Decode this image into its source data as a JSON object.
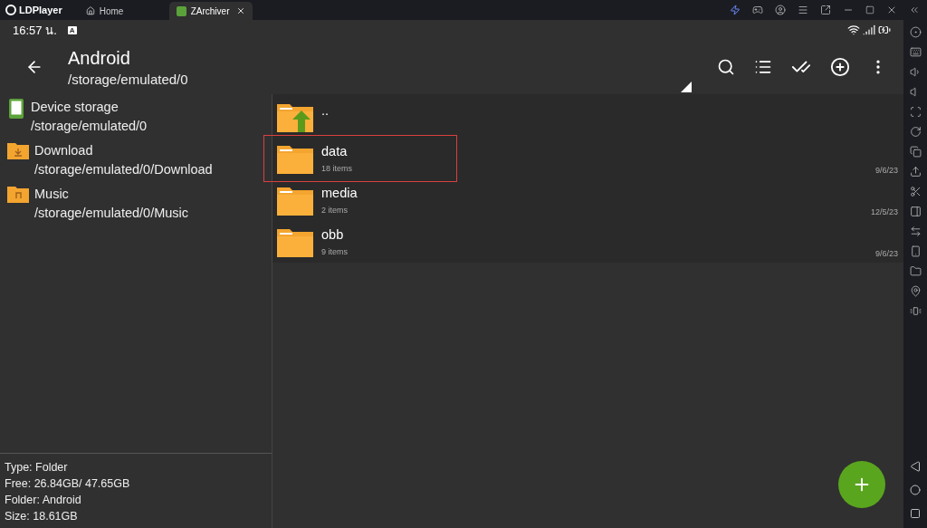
{
  "app": {
    "name": "LDPlayer"
  },
  "tabs": [
    {
      "label": "Home",
      "selected": false,
      "kind": "home"
    },
    {
      "label": "ZArchiver",
      "selected": true,
      "kind": "app"
    }
  ],
  "status_bar": {
    "time": "16:57 น.",
    "badge": "A"
  },
  "toolbar": {
    "title": "Android",
    "path": "/storage/emulated/0"
  },
  "places": [
    {
      "name": "Device storage",
      "path": "/storage/emulated/0",
      "kind": "storage"
    },
    {
      "name": "Download",
      "path": "/storage/emulated/0/Download",
      "kind": "download"
    },
    {
      "name": "Music",
      "path": "/storage/emulated/0/Music",
      "kind": "music"
    }
  ],
  "info": [
    "Type: Folder",
    "Free: 26.84GB/ 47.65GB",
    "Folder: Android",
    "Size: 18.61GB"
  ],
  "files": [
    {
      "name": "..",
      "kind": "up",
      "highlighted": false
    },
    {
      "name": "data",
      "count": "18 items",
      "date": "9/6/23",
      "kind": "folder",
      "highlighted": true
    },
    {
      "name": "media",
      "count": "2 items",
      "date": "12/5/23",
      "kind": "folder",
      "highlighted": false
    },
    {
      "name": "obb",
      "count": "9 items",
      "date": "9/6/23",
      "kind": "folder",
      "highlighted": false
    }
  ]
}
